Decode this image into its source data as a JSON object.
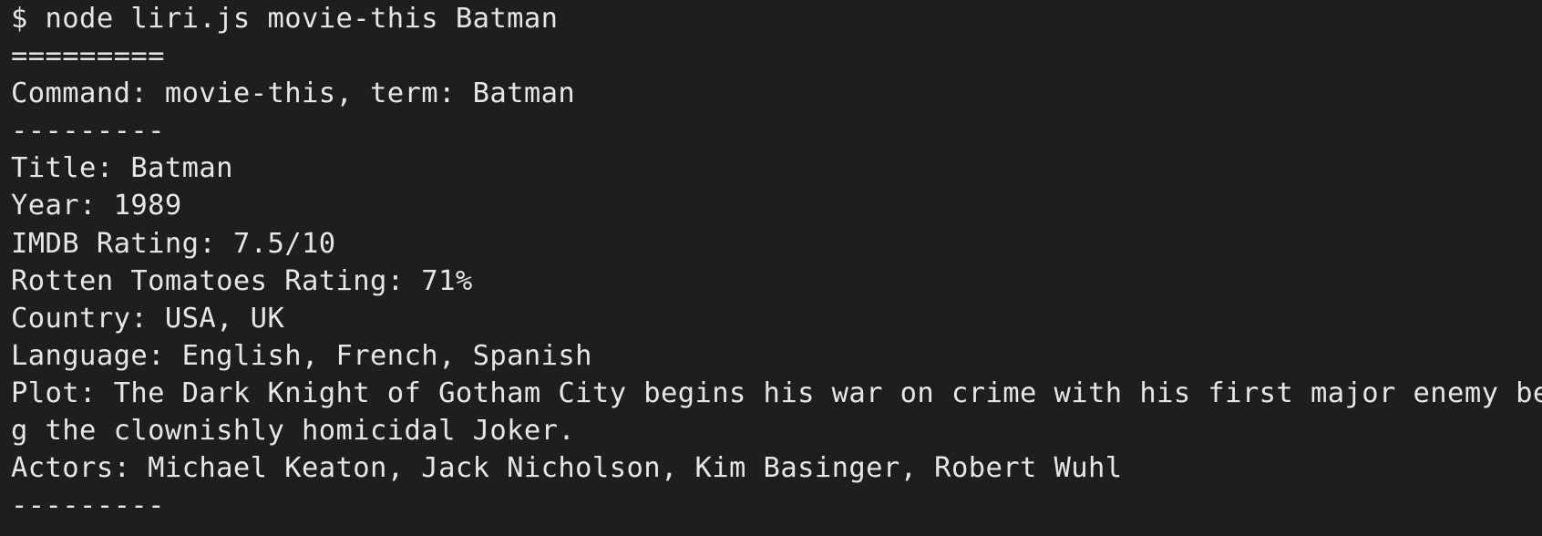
{
  "terminal": {
    "lines": [
      "$ node liri.js movie-this Batman",
      "=========",
      "Command: movie-this, term: Batman",
      "---------",
      "Title: Batman",
      "Year: 1989",
      "IMDB Rating: 7.5/10",
      "Rotten Tomatoes Rating: 71%",
      "Country: USA, UK",
      "Language: English, French, Spanish",
      "Plot: The Dark Knight of Gotham City begins his war on crime with his first major enemy bein",
      "g the clownishly homicidal Joker.",
      "Actors: Michael Keaton, Jack Nicholson, Kim Basinger, Robert Wuhl",
      "---------"
    ]
  },
  "colors": {
    "background": "#1e1e1e",
    "text": "#e6e6e6"
  }
}
